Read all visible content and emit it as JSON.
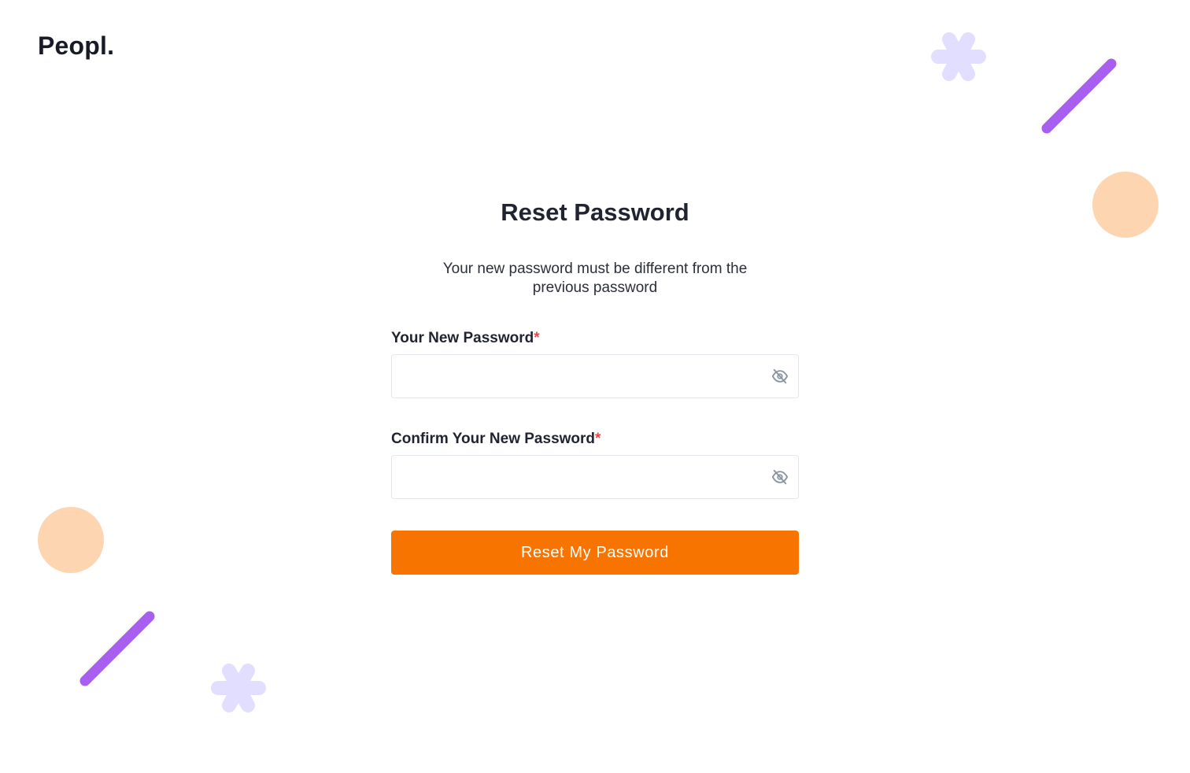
{
  "brand": {
    "logo_text": "Peopl."
  },
  "form": {
    "title": "Reset Password",
    "subtitle": "Your new password must be different from the previous password",
    "new_password": {
      "label": "Your New Password",
      "required_mark": "*",
      "value": "",
      "placeholder": "",
      "toggle_icon": "eye-off-icon"
    },
    "confirm_password": {
      "label": "Confirm Your New Password",
      "required_mark": "*",
      "value": "",
      "placeholder": "",
      "toggle_icon": "eye-off-icon"
    },
    "submit_label": "Reset My Password"
  },
  "colors": {
    "accent": "#f87400",
    "required": "#e5484d",
    "decor_purple": "#a85ff0",
    "decor_lavender": "#e1deff",
    "decor_peach": "#fdd5b0"
  },
  "decorations": [
    "asterisk-shape",
    "diagonal-line-shape",
    "circle-shape"
  ]
}
